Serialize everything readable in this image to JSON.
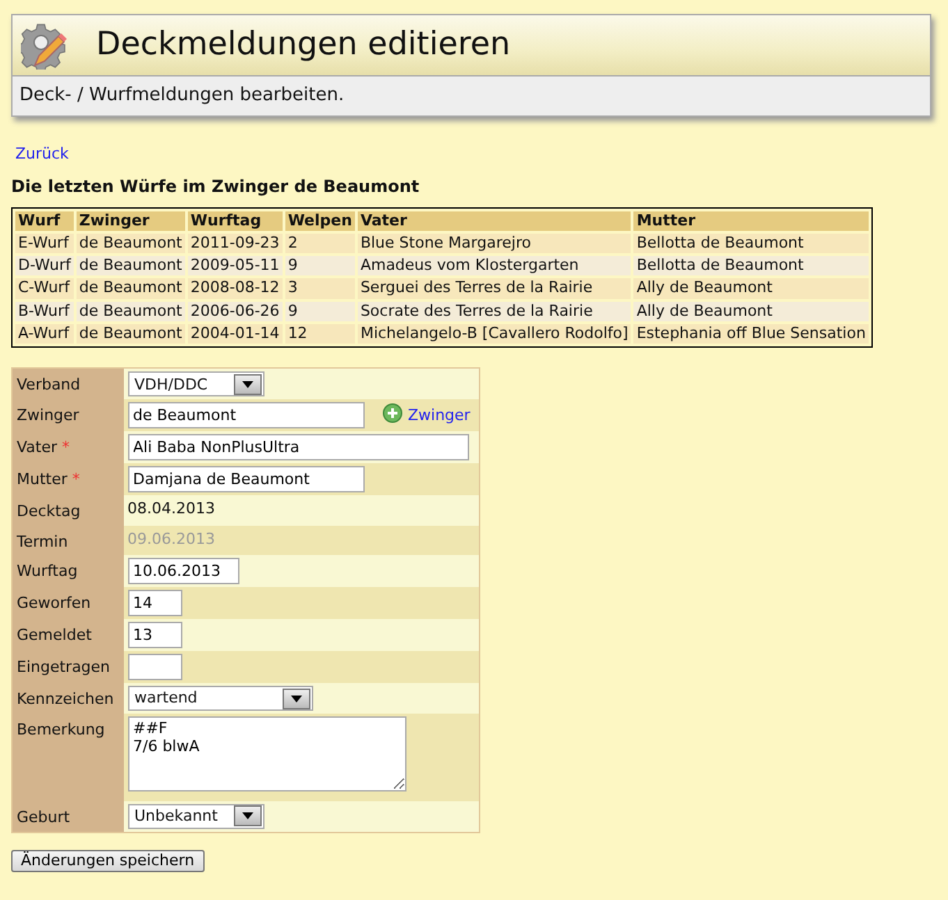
{
  "header": {
    "title": "Deckmeldungen editieren",
    "subtitle": "Deck- / Wurfmeldungen bearbeiten."
  },
  "back_link": "Zurück",
  "litters_heading": "Die letzten Würfe im Zwinger de Beaumont",
  "litters_table": {
    "columns": [
      "Wurf",
      "Zwinger",
      "Wurftag",
      "Welpen",
      "Vater",
      "Mutter"
    ],
    "rows": [
      [
        "E-Wurf",
        "de Beaumont",
        "2011-09-23",
        "2",
        "Blue Stone Margarejro",
        "Bellotta de Beaumont"
      ],
      [
        "D-Wurf",
        "de Beaumont",
        "2009-05-11",
        "9",
        "Amadeus vom Klostergarten",
        "Bellotta de Beaumont"
      ],
      [
        "C-Wurf",
        "de Beaumont",
        "2008-08-12",
        "3",
        "Serguei des Terres de la Rairie",
        "Ally de Beaumont"
      ],
      [
        "B-Wurf",
        "de Beaumont",
        "2006-06-26",
        "9",
        "Socrate des Terres de la Rairie",
        "Ally de Beaumont"
      ],
      [
        "A-Wurf",
        "de Beaumont",
        "2004-01-14",
        "12",
        "Michelangelo-B [Cavallero Rodolfo]",
        "Estephania off Blue Sensation"
      ]
    ]
  },
  "form": [
    {
      "label": "Verband",
      "kind": "select",
      "value": "VDH/DDC"
    },
    {
      "label": "Zwinger",
      "kind": "text",
      "value": "de Beaumont",
      "add_link": "Zwinger"
    },
    {
      "label": "Vater",
      "kind": "text",
      "value": "Ali Baba NonPlusUltra",
      "required_mark": "*"
    },
    {
      "label": "Mutter",
      "kind": "text",
      "value": "Damjana de Beaumont",
      "required_mark": "*"
    },
    {
      "label": "Decktag",
      "kind": "static",
      "value": "08.04.2013",
      "disabled": false
    },
    {
      "label": "Termin",
      "kind": "static",
      "value": "09.06.2013",
      "disabled": true
    },
    {
      "label": "Wurftag",
      "kind": "text",
      "value": "10.06.2013"
    },
    {
      "label": "Geworfen",
      "kind": "text",
      "value": "14"
    },
    {
      "label": "Gemeldet",
      "kind": "text",
      "value": "13"
    },
    {
      "label": "Eingetragen",
      "kind": "text"
    },
    {
      "label": "Kennzeichen",
      "kind": "select",
      "value": "wartend"
    },
    {
      "label": "Bemerkung",
      "kind": "textarea",
      "lines": [
        "##F",
        "7/6 blwA"
      ]
    },
    {
      "label": "Geburt",
      "kind": "select",
      "value": "Unbekannt"
    }
  ],
  "save_button": "Änderungen speichern"
}
